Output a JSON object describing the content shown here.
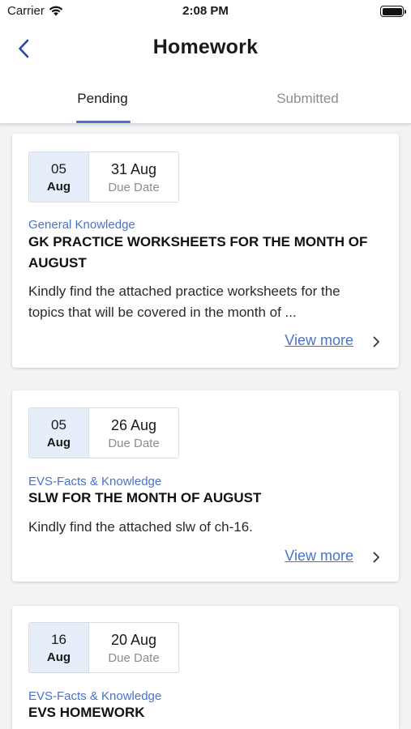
{
  "status_bar": {
    "carrier": "Carrier",
    "time": "2:08 PM"
  },
  "header": {
    "title": "Homework"
  },
  "tabs": [
    {
      "label": "Pending",
      "active": true
    },
    {
      "label": "Submitted",
      "active": false
    }
  ],
  "colors": {
    "accent": "#4a73c8",
    "date_highlight": "#e6eefa",
    "muted": "#8d8d92"
  },
  "homework": [
    {
      "assigned_day": "05",
      "assigned_month": "Aug",
      "due_date": "31 Aug",
      "due_label": "Due Date",
      "subject": "General Knowledge",
      "title": "GK PRACTICE WORKSHEETS FOR THE MONTH OF AUGUST",
      "description": "Kindly find the attached practice worksheets for the topics that will be covered in the month of ...",
      "action": "View more"
    },
    {
      "assigned_day": "05",
      "assigned_month": "Aug",
      "due_date": "26 Aug",
      "due_label": "Due Date",
      "subject": "EVS-Facts & Knowledge",
      "title": "SLW FOR THE MONTH OF AUGUST",
      "description": "Kindly find the attached slw of ch-16.",
      "action": "View more"
    },
    {
      "assigned_day": "16",
      "assigned_month": "Aug",
      "due_date": "20 Aug",
      "due_label": "Due Date",
      "subject": "EVS-Facts & Knowledge",
      "title": "EVS HOMEWORK",
      "description": "",
      "action": ""
    }
  ]
}
